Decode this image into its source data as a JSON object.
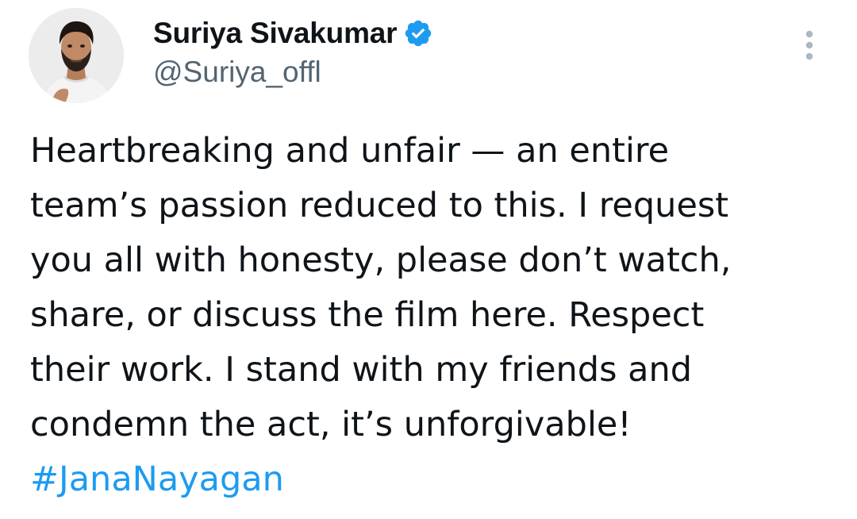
{
  "author": {
    "display_name": "Suriya Sivakumar",
    "handle": "@Suriya_offl",
    "verified": true,
    "verified_icon": "verified-badge-icon",
    "avatar_icon": "profile-photo"
  },
  "more_icon": "more-vertical-icon",
  "tweet": {
    "lines": [
      "Heartbreaking and unfair — an entire",
      "team’s passion reduced to this. I request",
      "you all with honesty, please don’t watch,",
      "share, or discuss the film here. Respect",
      "their work. I stand with my friends and",
      "condemn the act, it’s unforgivable!"
    ],
    "hashtag": "#JanaNayagan"
  },
  "colors": {
    "text": "#0f1419",
    "secondary": "#536471",
    "accent": "#1d9bf0",
    "background": "#ffffff"
  }
}
